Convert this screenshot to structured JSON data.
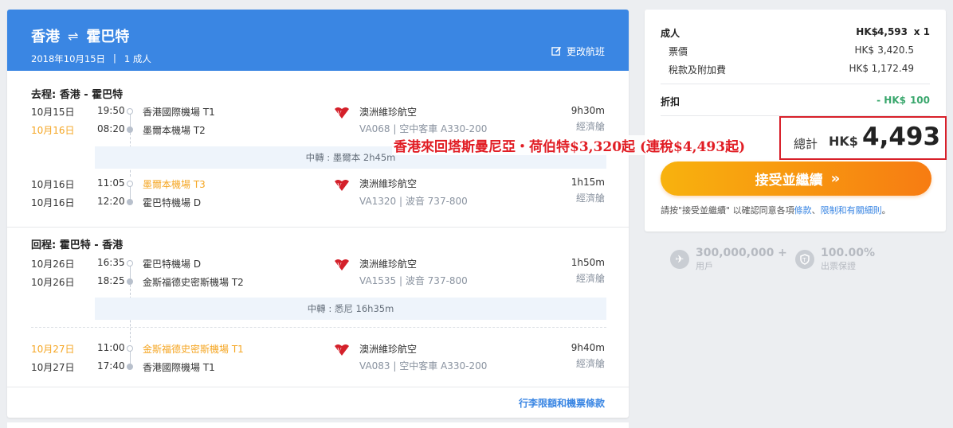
{
  "header": {
    "origin": "香港",
    "swap": "⇌",
    "destination": "霍巴特",
    "date": "2018年10月15日",
    "sep": "|",
    "passengers": "1 成人",
    "change_label": "更改航班"
  },
  "outbound": {
    "title": "去程: 香港 - 霍巴特",
    "legs": [
      {
        "dep_date": "10月15日",
        "dep_time": "19:50",
        "dep_airport": "香港國際機場 T1",
        "arr_date": "10月16日",
        "arr_time": "08:20",
        "arr_airport": "墨爾本機場 T2",
        "airline": "澳洲維珍航空",
        "flight": "VA068 | 空中客車 A330-200",
        "duration": "9h30m",
        "cabin": "經濟艙"
      },
      {
        "dep_date": "10月16日",
        "dep_time": "11:05",
        "dep_airport": "墨爾本機場 T3",
        "arr_date": "10月16日",
        "arr_time": "12:20",
        "arr_airport": "霍巴特機場 D",
        "airline": "澳洲維珍航空",
        "flight": "VA1320 | 波音 737-800",
        "duration": "1h15m",
        "cabin": "經濟艙"
      }
    ],
    "transfer": "中轉 : 墨爾本 2h45m"
  },
  "inbound": {
    "title": "回程: 霍巴特 - 香港",
    "legs": [
      {
        "dep_date": "10月26日",
        "dep_time": "16:35",
        "dep_airport": "霍巴特機場 D",
        "arr_date": "10月26日",
        "arr_time": "18:25",
        "arr_airport": "金斯福德史密斯機場 T2",
        "airline": "澳洲維珍航空",
        "flight": "VA1535 | 波音 737-800",
        "duration": "1h50m",
        "cabin": "經濟艙"
      },
      {
        "dep_date": "10月27日",
        "dep_time": "11:00",
        "dep_airport": "金斯福德史密斯機場 T1",
        "arr_date": "10月27日",
        "arr_time": "17:40",
        "arr_airport": "香港國際機場 T1",
        "airline": "澳洲維珍航空",
        "flight": "VA083 | 空中客車 A330-200",
        "duration": "9h40m",
        "cabin": "經濟艙"
      }
    ],
    "transfer": "中轉 : 悉尼 16h35m"
  },
  "baggage_link": "行李限額和機票條款",
  "price": {
    "adult_label": "成人",
    "adult_cur": "HK$",
    "adult_amount": "4,593",
    "adult_qty": "x 1",
    "fare_label": "票價",
    "fare_cur": "HK$",
    "fare_amount": "3,420.5",
    "tax_label": "稅款及附加費",
    "tax_cur": "HK$",
    "tax_amount": "1,172.49",
    "discount_label": "折扣",
    "discount_cur": "- HK$",
    "discount_amount": "100",
    "total_label": "總計",
    "total_cur": "HK$",
    "total_amount": "4,493"
  },
  "cta": {
    "label": "接受並繼續",
    "chevron": "»"
  },
  "terms": {
    "prefix": "請按\"接受並繼續\" 以確認同意各項",
    "link1": "條款",
    "sep": "、",
    "link2": "限制和有關細則",
    "suffix": "。"
  },
  "overlay_text": "香港來回塔斯曼尼亞・荷伯特$3,320起 (連稅$4,493起)",
  "stats": [
    {
      "icon": "plane-icon",
      "number": "300,000,000 +",
      "label": "用戶"
    },
    {
      "icon": "shield-icon",
      "number": "100.00%",
      "label": "出票保證"
    }
  ],
  "colors": {
    "brand": "#3a86e3",
    "orange": "#f5a623",
    "cta_start": "#f8b20e",
    "cta_end": "#f77c12",
    "highlight": "#d8202a"
  }
}
